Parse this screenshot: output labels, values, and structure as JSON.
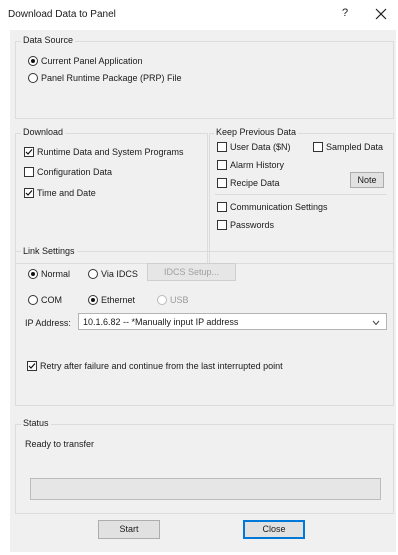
{
  "window": {
    "title": "Download Data to Panel",
    "help_label": "?"
  },
  "data_source": {
    "legend": "Data Source",
    "options": [
      {
        "label": "Current Panel Application",
        "selected": true
      },
      {
        "label": "Panel Runtime Package (PRP) File",
        "selected": false
      }
    ]
  },
  "download": {
    "legend": "Download",
    "items": [
      {
        "label": "Runtime Data and System Programs",
        "checked": true
      },
      {
        "label": "Configuration Data",
        "checked": false
      },
      {
        "label": "Time and Date",
        "checked": true
      }
    ]
  },
  "keep_previous": {
    "legend": "Keep Previous Data",
    "user_data": "User Data ($N)",
    "sampled_data": "Sampled Data",
    "alarm_history": "Alarm History",
    "recipe_data": "Recipe Data",
    "note_label": "Note",
    "communication_settings": "Communication Settings",
    "passwords": "Passwords"
  },
  "link": {
    "legend": "Link Settings",
    "normal": "Normal",
    "via_idcs": "Via IDCS",
    "idcs_setup": "IDCS Setup...",
    "com": "COM",
    "ethernet": "Ethernet",
    "usb": "USB",
    "ip_label": "IP Address:",
    "ip_value": "10.1.6.82 -- *Manually input IP address",
    "retry": "Retry after failure and continue from the last interrupted point"
  },
  "status": {
    "legend": "Status",
    "text": "Ready to transfer",
    "progress": 0
  },
  "buttons": {
    "start": "Start",
    "close": "Close"
  }
}
